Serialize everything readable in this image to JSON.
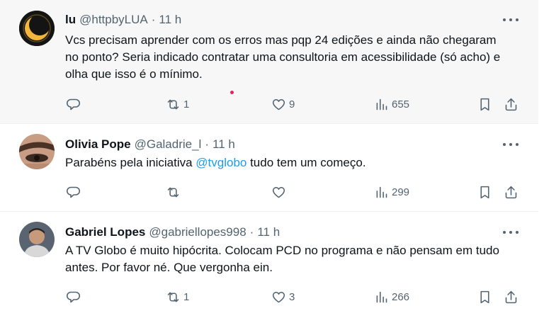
{
  "tweets": [
    {
      "name": "lu",
      "handle": "@httpbyLUA",
      "sep": "·",
      "time": "11 h",
      "text": "Vcs precisam aprender com os erros mas pqp 24 edições e ainda não chegaram no ponto? Seria indicado contratar uma consultoria em acessibilidade (só acho) e olha que isso é o mínimo.",
      "reposts": "1",
      "likes": "9",
      "views": "655"
    },
    {
      "name": "Olivia Pope",
      "handle": "@Galadrie_l",
      "sep": "·",
      "time": "11 h",
      "text_before": "Parabéns pela iniciativa ",
      "mention": "@tvglobo",
      "text_after": " tudo tem um começo.",
      "reposts": "",
      "likes": "",
      "views": "299"
    },
    {
      "name": "Gabriel Lopes",
      "handle": "@gabriellopes998",
      "sep": "·",
      "time": "11 h",
      "text": "A TV Globo é muito hipócrita. Colocam PCD no programa e não pensam em tudo antes. Por favor né. Que vergonha ein.",
      "reposts": "1",
      "likes": "3",
      "views": "266"
    }
  ],
  "icons": [
    "more-icon",
    "reply-icon",
    "repost-icon",
    "like-icon",
    "views-icon",
    "bookmark-icon",
    "share-icon"
  ],
  "colors": {
    "text": "#0f1419",
    "secondary": "#536471",
    "link": "#1d9bf0",
    "hover_bg": "#f7f7f7"
  }
}
